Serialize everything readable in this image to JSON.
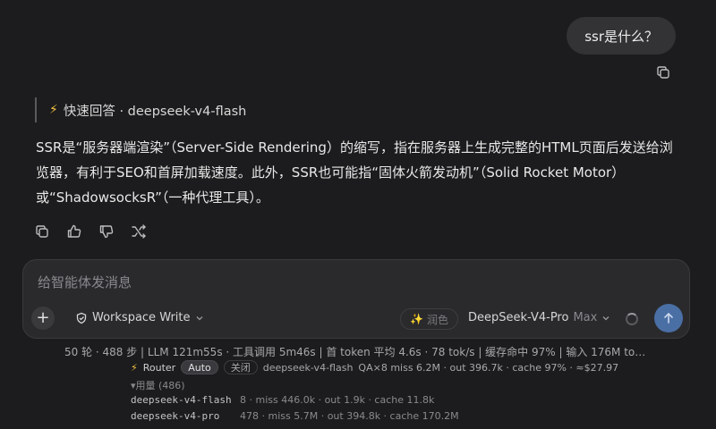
{
  "user_message": "ssr是什么？",
  "assistant": {
    "header": "快速回答 · deepseek-v4-flash",
    "answer": "SSR是“服务器端渲染”（Server-Side Rendering）的缩写，指在服务器上生成完整的HTML页面后发送给浏览器，有利于SEO和首屏加载速度。此外，SSR也可能指“固体火箭发动机”（Solid Rocket Motor）或“ShadowsocksR”（一种代理工具）。"
  },
  "composer": {
    "placeholder": "给智能体发消息",
    "workspace_mode": "Workspace Write",
    "polish_label": "润色",
    "model": "DeepSeek-V4-Pro",
    "tier": "Max"
  },
  "status": {
    "stats_line": "50 轮 · 488 步   |   LLM 121m55s · 工具调用 5m46s   |   首 token 平均 4.6s · 78 tok/s   |   缓存命中 97%   |   输入 176M to…",
    "router": {
      "label": "Router",
      "auto": "Auto",
      "off": "关闭",
      "model": "deepseek-v4-flash",
      "details": "QA×8  miss 6.2M · out 396.7k · cache 97% · ≈$27.97"
    },
    "usage_toggle": "▾用量 (486)",
    "usage_rows": [
      {
        "model": "deepseek-v4-flash",
        "stats": "8 · miss 446.0k · out 1.9k · cache 11.8k"
      },
      {
        "model": "deepseek-v4-pro",
        "stats": "478 · miss 5.7M · out 394.8k · cache 170.2M"
      }
    ]
  },
  "icons": {
    "copy": "copy-icon",
    "thumbs_up": "thumbs-up-icon",
    "thumbs_down": "thumbs-down-icon",
    "regenerate": "regenerate-icon",
    "plus": "plus-icon",
    "send": "arrow-up-icon"
  },
  "colors": {
    "background": "#1c1c1e",
    "send_button": "#4a6fa5",
    "bolt": "#f5c542"
  }
}
